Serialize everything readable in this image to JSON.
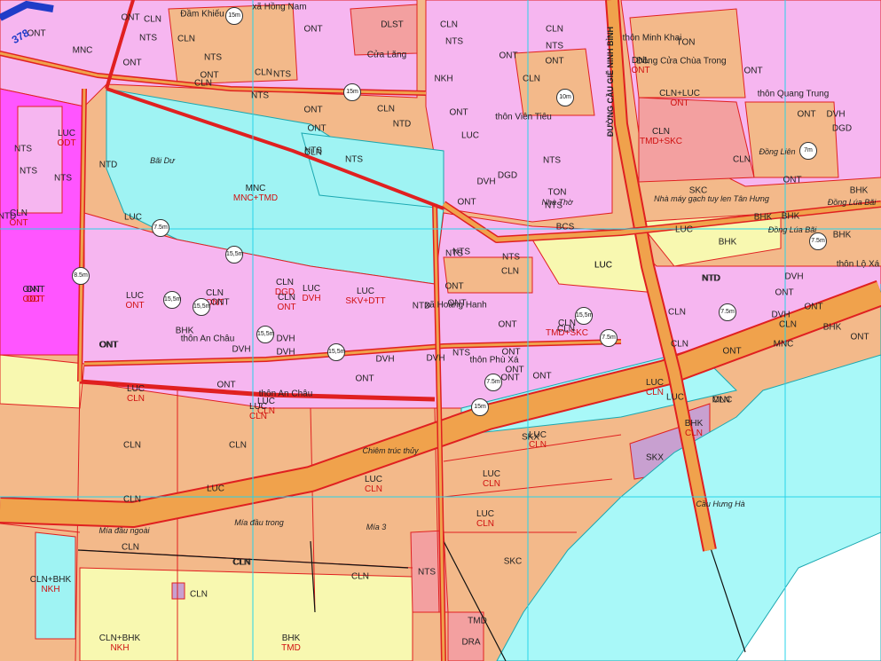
{
  "colors": {
    "residential_pink": "#f6b6f0",
    "urban_magenta": "#ff55ff",
    "aquaculture_cyan": "#9ff3f3",
    "perennial_orange": "#f3b98a",
    "rice_yellow": "#f8f8b0",
    "river_cyan": "#a8f8f8",
    "road_orange": "#f0a24c",
    "boundary_red": "#e02020",
    "grid_cyan": "#28d3e8",
    "industry_salmon": "#f3a0a0",
    "mining_purple": "#c8a0d0",
    "grey_land": "#c8c8c8"
  },
  "map": {
    "labels": [
      {
        "code": "CLN",
        "sub": ""
      },
      {
        "code": "ONT",
        "sub": ""
      },
      {
        "code": "NTS",
        "sub": ""
      },
      {
        "code": "DLST",
        "sub": ""
      },
      {
        "code": "CLN",
        "sub": ""
      },
      {
        "code": "NTS",
        "sub": ""
      },
      {
        "code": "CLN",
        "sub": ""
      },
      {
        "code": "NTS",
        "sub": ""
      },
      {
        "code": "ONT",
        "sub": ""
      },
      {
        "code": "ONT",
        "sub": ""
      },
      {
        "code": "ONT",
        "sub": ""
      },
      {
        "code": "NTS",
        "sub": ""
      },
      {
        "code": "ONT",
        "sub": ""
      },
      {
        "code": "MNC",
        "sub": ""
      },
      {
        "code": "ONT",
        "sub": ""
      },
      {
        "code": "CLN",
        "sub": ""
      },
      {
        "code": "NTS",
        "sub": ""
      },
      {
        "code": "NKH",
        "sub": ""
      },
      {
        "code": "CLN",
        "sub": ""
      },
      {
        "code": "CLN",
        "sub": ""
      },
      {
        "code": "ONT",
        "sub": ""
      },
      {
        "code": "CLN",
        "sub": ""
      },
      {
        "code": "NTS",
        "sub": ""
      },
      {
        "code": "ONT",
        "sub": ""
      },
      {
        "code": "TON",
        "sub": ""
      },
      {
        "code": "CLN",
        "sub": ""
      },
      {
        "code": "ONT",
        "sub": ""
      },
      {
        "code": "DNL",
        "sub": "ONT"
      },
      {
        "code": "ONT",
        "sub": ""
      },
      {
        "code": "CLN+LUC",
        "sub": "ONT"
      },
      {
        "code": "ONT",
        "sub": ""
      },
      {
        "code": "DVH",
        "sub": ""
      },
      {
        "code": "DGD",
        "sub": ""
      },
      {
        "code": "CLN",
        "sub": "TMD+SKC"
      },
      {
        "code": "CLN",
        "sub": ""
      },
      {
        "code": "ONT",
        "sub": ""
      },
      {
        "code": "LUC",
        "sub": "ODT"
      },
      {
        "code": "NTD",
        "sub": ""
      },
      {
        "code": "LUC",
        "sub": ""
      },
      {
        "code": "ONT",
        "sub": "ODT"
      },
      {
        "code": "NTS",
        "sub": ""
      },
      {
        "code": "NTS",
        "sub": ""
      },
      {
        "code": "NTS",
        "sub": ""
      },
      {
        "code": "NTD",
        "sub": ""
      },
      {
        "code": "CLN",
        "sub": "ONT"
      },
      {
        "code": "DGD",
        "sub": ""
      },
      {
        "code": "ONT",
        "sub": ""
      },
      {
        "code": "DVH",
        "sub": ""
      },
      {
        "code": "NTS",
        "sub": ""
      },
      {
        "code": "TON",
        "sub": ""
      },
      {
        "code": "NTS",
        "sub": ""
      },
      {
        "code": "BCS",
        "sub": ""
      },
      {
        "code": "SKC",
        "sub": ""
      },
      {
        "code": "BHK",
        "sub": ""
      },
      {
        "code": "BHK",
        "sub": ""
      },
      {
        "code": "BHK",
        "sub": ""
      },
      {
        "code": "LUC",
        "sub": ""
      },
      {
        "code": "BHK",
        "sub": ""
      },
      {
        "code": "LUC",
        "sub": ""
      },
      {
        "code": "MNC",
        "sub": "MNC+TMD"
      },
      {
        "code": "DVH",
        "sub": ""
      },
      {
        "code": "NTD",
        "sub": ""
      },
      {
        "code": "LUC",
        "sub": "ONT"
      },
      {
        "code": "NTS",
        "sub": ""
      },
      {
        "code": "NTS",
        "sub": ""
      },
      {
        "code": "ONT",
        "sub": ""
      },
      {
        "code": "CLN",
        "sub": ""
      },
      {
        "code": "NTD",
        "sub": ""
      },
      {
        "code": "LUC",
        "sub": ""
      },
      {
        "code": "NTD",
        "sub": ""
      },
      {
        "code": "BHK",
        "sub": ""
      },
      {
        "code": "CLN",
        "sub": "DGD"
      },
      {
        "code": "LUC",
        "sub": "DVH"
      },
      {
        "code": "LUC",
        "sub": "SKV+DTT"
      },
      {
        "code": "CLN",
        "sub": "ONT"
      },
      {
        "code": "CLN",
        "sub": "ONT"
      },
      {
        "code": "DVH",
        "sub": ""
      },
      {
        "code": "ONT",
        "sub": ""
      },
      {
        "code": "NTS",
        "sub": ""
      },
      {
        "code": "ONT",
        "sub": ""
      },
      {
        "code": "CLN",
        "sub": "TMD+SKC"
      },
      {
        "code": "ONT",
        "sub": ""
      },
      {
        "code": "DVH",
        "sub": ""
      },
      {
        "code": "ONT",
        "sub": ""
      },
      {
        "code": "ONT",
        "sub": ""
      },
      {
        "code": "LUC",
        "sub": "CLN"
      },
      {
        "code": "CLN",
        "sub": ""
      },
      {
        "code": "LUC",
        "sub": "CLN"
      },
      {
        "code": "LUC",
        "sub": "CLN"
      },
      {
        "code": "CLN",
        "sub": ""
      },
      {
        "code": "LUC",
        "sub": ""
      },
      {
        "code": "CLN",
        "sub": ""
      },
      {
        "code": "CLN",
        "sub": ""
      },
      {
        "code": "CLN",
        "sub": ""
      },
      {
        "code": "LUC",
        "sub": "CLN"
      },
      {
        "code": "LUC",
        "sub": "CLN"
      },
      {
        "code": "LUC",
        "sub": "CLN"
      },
      {
        "code": "SKX",
        "sub": ""
      },
      {
        "code": "SKX",
        "sub": ""
      },
      {
        "code": "BHK",
        "sub": "CLN"
      },
      {
        "code": "SKC",
        "sub": ""
      },
      {
        "code": "NTS",
        "sub": ""
      },
      {
        "code": "CLN+BHK",
        "sub": "NKH"
      },
      {
        "code": "CLN+BHK",
        "sub": "NKH"
      },
      {
        "code": "BHK",
        "sub": "TMD"
      },
      {
        "code": "TMD",
        "sub": ""
      },
      {
        "code": "DRA",
        "sub": ""
      },
      {
        "code": "CLN",
        "sub": ""
      },
      {
        "code": "MNC",
        "sub": ""
      },
      {
        "code": "MNC",
        "sub": ""
      },
      {
        "code": "BHK",
        "sub": ""
      },
      {
        "code": "ONT",
        "sub": ""
      },
      {
        "code": "NTD",
        "sub": ""
      },
      {
        "code": "LUC",
        "sub": "CLN"
      },
      {
        "code": "BHK",
        "sub": ""
      },
      {
        "code": "CLN",
        "sub": ""
      },
      {
        "code": "NTS",
        "sub": ""
      },
      {
        "code": "ONT",
        "sub": "ODT"
      },
      {
        "code": "NTS",
        "sub": ""
      },
      {
        "code": "DVH",
        "sub": ""
      },
      {
        "code": "ONT",
        "sub": ""
      },
      {
        "code": "CLN",
        "sub": ""
      },
      {
        "code": "LUC",
        "sub": ""
      },
      {
        "code": "CLN",
        "sub": ""
      },
      {
        "code": "CLN",
        "sub": ""
      },
      {
        "code": "CLN",
        "sub": ""
      },
      {
        "code": "CLN",
        "sub": ""
      },
      {
        "code": "ONT",
        "sub": ""
      },
      {
        "code": "ONT",
        "sub": ""
      },
      {
        "code": "LUC",
        "sub": "CLN"
      },
      {
        "code": "DVH",
        "sub": ""
      },
      {
        "code": "DVH",
        "sub": ""
      },
      {
        "code": "ONT",
        "sub": ""
      },
      {
        "code": "ONT",
        "sub": ""
      },
      {
        "code": "ONT",
        "sub": ""
      },
      {
        "code": "NTS",
        "sub": ""
      },
      {
        "code": "ONT",
        "sub": ""
      },
      {
        "code": "ONT",
        "sub": ""
      },
      {
        "code": "DVH",
        "sub": ""
      },
      {
        "code": "ONT",
        "sub": ""
      },
      {
        "code": "CLN",
        "sub": ""
      },
      {
        "code": "ONT",
        "sub": ""
      },
      {
        "code": "CLN",
        "sub": ""
      },
      {
        "code": "LUC",
        "sub": ""
      }
    ],
    "places": [
      "Đầm Khiếu",
      "xã Hồng Nam",
      "Cửa Lăng",
      "thôn Minh Khai",
      "Đồng Cửa Chùa Trong",
      "thôn Quang Trung",
      "thôn Viên Tiêu",
      "Đồng Liên",
      "Bãi Dư",
      "Nhà máy gạch tuy len Tân Hưng",
      "Đồng Lúa Bãi",
      "Đồng Lúa Bãi",
      "thôn Lộ Xá",
      "Nhà Thờ",
      "xã Hoàng Hanh",
      "thôn An Châu",
      "thôn An Châu",
      "thôn Phù Xá",
      "Chiêm trúc thủy",
      "Mía đầu ngoài",
      "Mía đầu trong",
      "Mía 3",
      "Cầu Hưng Hà"
    ],
    "road_widths": [
      "15m",
      "15m",
      "10m",
      "7m",
      "7.5m",
      "15,5m",
      "15,5m",
      "15,5m",
      "15,5m",
      "15,5m",
      "15,5m",
      "7.5m",
      "15m",
      "7.5m",
      "7.5m",
      "8.5m",
      "7.5m"
    ],
    "road_names": [
      "ĐƯỜNG CẦU GIẼ NINH BÌNH"
    ],
    "edge_text": "378"
  }
}
